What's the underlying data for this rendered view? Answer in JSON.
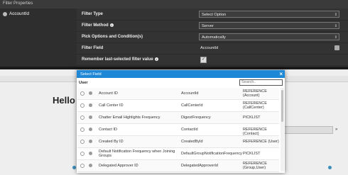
{
  "window": {
    "title": "Filter Properties"
  },
  "left": {
    "item_label": "AccountId"
  },
  "properties": [
    {
      "label": "Filter Type",
      "kind": "select",
      "value": "Select Option"
    },
    {
      "label": "Filter Method",
      "info": true,
      "kind": "select",
      "value": "Server"
    },
    {
      "label": "Pick Options and Condition(s)",
      "kind": "select",
      "value": "Automatically"
    },
    {
      "label": "Filter Field",
      "kind": "text",
      "value": "AccountId"
    },
    {
      "label": "Remember last-selected filter value",
      "info": true,
      "kind": "checkbox",
      "checked": true
    }
  ],
  "background": {
    "heading": "Hello V"
  },
  "modal": {
    "title": "Select Field",
    "close": "×",
    "user_label": "User",
    "search_placeholder": "Search..",
    "rows": [
      {
        "label": "Account ID",
        "api": "AccountId",
        "type": "REFERENCE (Account)"
      },
      {
        "label": "Call Center ID",
        "api": "CallCenterId",
        "type": "REFERENCE (CallCenter)"
      },
      {
        "label": "Chatter Email Highlights Frequency",
        "api": "DigestFrequency",
        "type": "PICKLIST"
      },
      {
        "label": "Contact ID",
        "api": "ContactId",
        "type": "REFERENCE (Contact)"
      },
      {
        "label": "Created By ID",
        "api": "CreatedById",
        "type": "REFERENCE (User)"
      },
      {
        "label": "Default Notification Frequency when Joining Groups",
        "api": "DefaultGroupNotificationFrequency",
        "type": "PICKLIST"
      },
      {
        "label": "Delegated Approver ID",
        "api": "DelegatedApproverId",
        "type": "REFERENCE (Group,User)"
      }
    ]
  }
}
